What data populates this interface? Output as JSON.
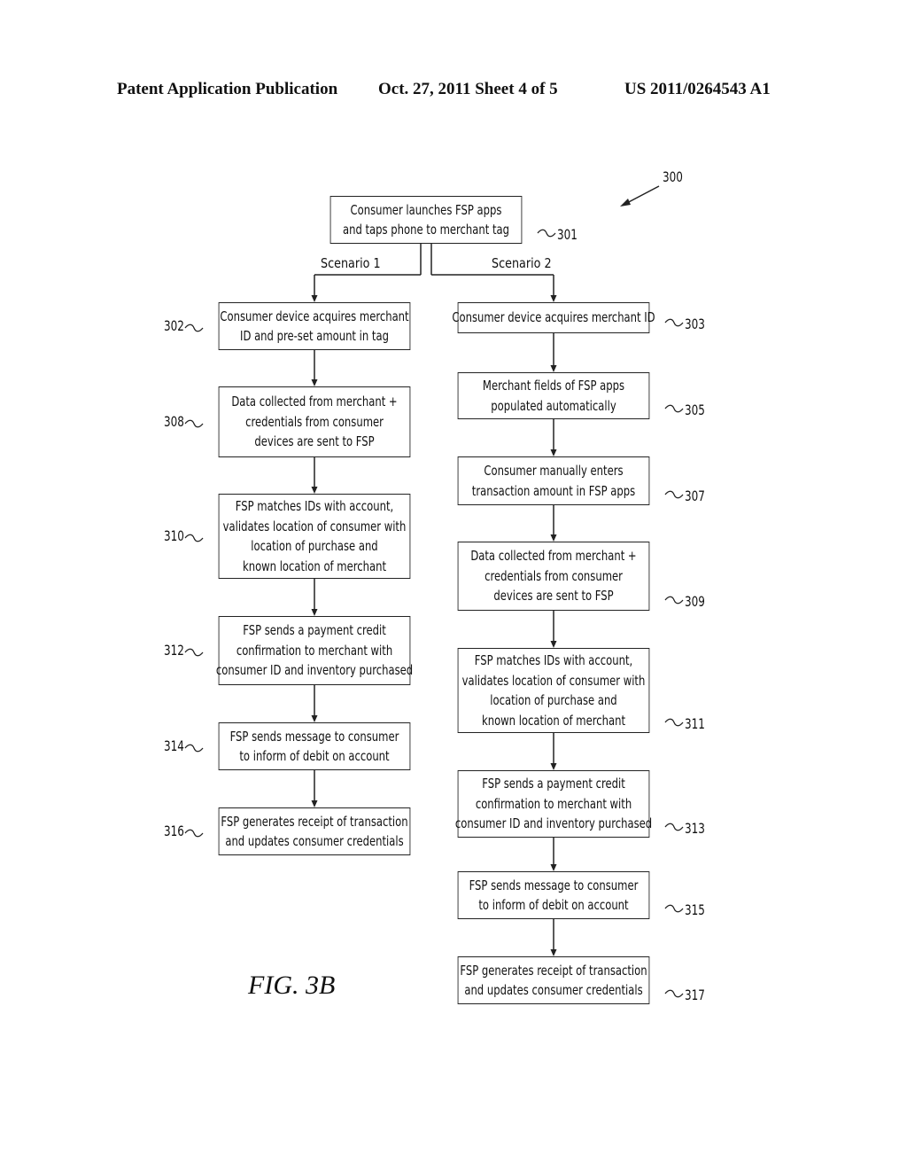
{
  "header": {
    "left": "Patent Application Publication",
    "center": "Oct. 27, 2011   Sheet 4 of 5",
    "right": "US 2011/0264543 A1"
  },
  "figure_label": "FIG.  3B",
  "diagram_ref": "300",
  "start": {
    "ref": "301",
    "lines": [
      "Consumer launches FSP apps",
      "and taps phone to merchant tag"
    ]
  },
  "branches": [
    "Scenario 1",
    "Scenario 2"
  ],
  "scenario1": [
    {
      "ref": "302",
      "lines": [
        "Consumer device acquires merchant",
        "ID and pre-set amount in tag"
      ]
    },
    {
      "ref": "308",
      "lines": [
        "Data collected from merchant +",
        "credentials from consumer",
        "devices are sent to FSP"
      ]
    },
    {
      "ref": "310",
      "lines": [
        "FSP matches IDs with account,",
        "validates location of consumer with",
        "location of purchase and",
        "known location of merchant"
      ]
    },
    {
      "ref": "312",
      "lines": [
        "FSP sends a payment credit",
        "confirmation to merchant with",
        "consumer ID and inventory purchased"
      ]
    },
    {
      "ref": "314",
      "lines": [
        "FSP sends message to consumer",
        "to inform of debit on account"
      ]
    },
    {
      "ref": "316",
      "lines": [
        "FSP generates receipt of transaction",
        "and updates consumer credentials"
      ]
    }
  ],
  "scenario2": [
    {
      "ref": "303",
      "lines": [
        "Consumer device acquires merchant ID"
      ]
    },
    {
      "ref": "305",
      "lines": [
        "Merchant fields of FSP apps",
        "populated automatically"
      ]
    },
    {
      "ref": "307",
      "lines": [
        "Consumer manually enters",
        "transaction amount in FSP apps"
      ]
    },
    {
      "ref": "309",
      "lines": [
        "Data collected from merchant +",
        "credentials from consumer",
        "devices are sent to FSP"
      ]
    },
    {
      "ref": "311",
      "lines": [
        "FSP matches IDs with account,",
        "validates location of consumer with",
        "location of purchase and",
        "known location of merchant"
      ]
    },
    {
      "ref": "313",
      "lines": [
        "FSP sends a payment credit",
        "confirmation to merchant with",
        "consumer ID and inventory purchased"
      ]
    },
    {
      "ref": "315",
      "lines": [
        "FSP sends message to consumer",
        "to inform of debit on account"
      ]
    },
    {
      "ref": "317",
      "lines": [
        "FSP generates receipt of transaction",
        "and updates consumer credentials"
      ]
    }
  ]
}
